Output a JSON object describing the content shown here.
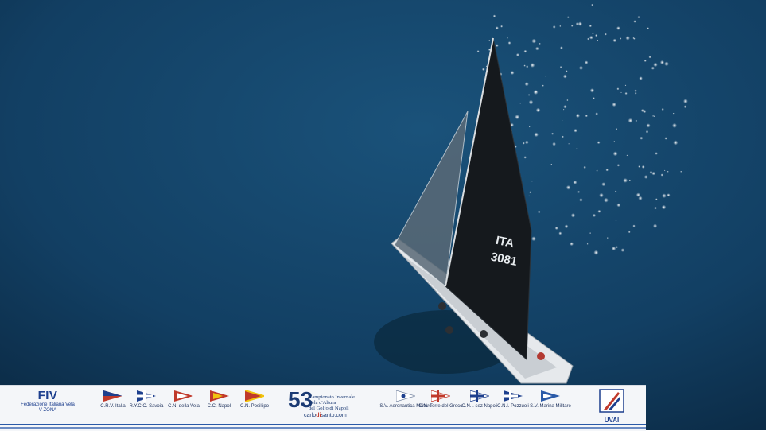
{
  "boat": {
    "sail_country": "ITA",
    "sail_number": "3081"
  },
  "banner": {
    "fiv": {
      "logo": "FIV",
      "name": "Federazione Italiana Vela",
      "zone": "V ZONA"
    },
    "clubs_left": [
      {
        "label": "C.R.V. Italia"
      },
      {
        "label": "R.Y.C.C. Savoia"
      },
      {
        "label": "C.N. della Vela"
      },
      {
        "label": "C.C. Napoli"
      },
      {
        "label": "C.N. Posillipo"
      }
    ],
    "event": {
      "number": "53",
      "line1": "Campionato Invernale",
      "line2": "Vela d'Altura",
      "line3": "del Golfo di Napoli",
      "photographer_a": "carlo",
      "photographer_b": "di",
      "photographer_c": "santo.com"
    },
    "clubs_right": [
      {
        "label": "S.V. Aeronautica Militare"
      },
      {
        "label": "C.N. Torre del Greco"
      },
      {
        "label": "C.N.I. sez Napoli"
      },
      {
        "label": "C.N.I. Pozzuoli"
      },
      {
        "label": "S.V. Marina Militare"
      }
    ],
    "uvai": {
      "label": "UVAI"
    }
  },
  "colors": {
    "sea_dark": "#0b2a45",
    "sea_mid": "#14476b",
    "sail": "#15191d",
    "brand_blue": "#1d3f8e"
  }
}
